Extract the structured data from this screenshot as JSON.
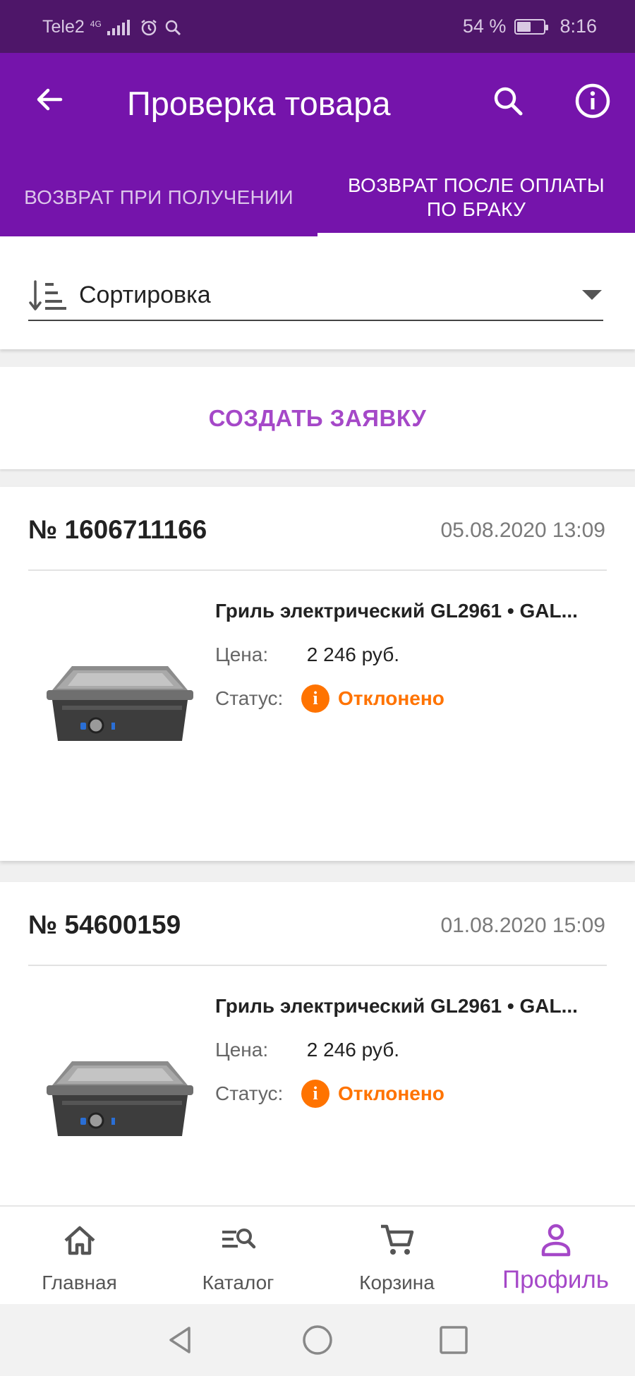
{
  "status_bar": {
    "carrier": "Tele2",
    "network": "4G",
    "battery": "54 %",
    "battery_level": 0.54,
    "time": "8:16"
  },
  "header": {
    "title": "Проверка товара",
    "icons": [
      "arrow-back-icon",
      "search-icon",
      "info-icon"
    ]
  },
  "tabs": [
    {
      "label": "ВОЗВРАТ ПРИ ПОЛУЧЕНИИ",
      "active": false
    },
    {
      "label": "ВОЗВРАТ ПОСЛЕ ОПЛАТЫ ПО БРАКУ",
      "active": true
    }
  ],
  "sort": {
    "label": "Сортировка"
  },
  "create_button": "СОЗДАТЬ ЗАЯВКУ",
  "orders": [
    {
      "number": "№ 1606711166",
      "date": "05.08.2020 13:09",
      "product": "Гриль электрический GL2961 • GAL...",
      "price_label": "Цена:",
      "price": "2 246 руб.",
      "status_label": "Статус:",
      "status": "Отклонено"
    },
    {
      "number": "№ 54600159",
      "date": "01.08.2020 15:09",
      "product": "Гриль электрический GL2961 • GAL...",
      "price_label": "Цена:",
      "price": "2 246 руб.",
      "status_label": "Статус:",
      "status": "Отклонено"
    }
  ],
  "bottom_nav": [
    {
      "label": "Главная",
      "icon": "home-icon",
      "active": false
    },
    {
      "label": "Каталог",
      "icon": "catalog-search-icon",
      "active": false
    },
    {
      "label": "Корзина",
      "icon": "cart-icon",
      "active": false
    },
    {
      "label": "Профиль",
      "icon": "profile-icon",
      "active": true
    }
  ],
  "colors": {
    "brand": "#7514ab",
    "status_bar": "#4e1669",
    "accent": "#a548c8",
    "status_rejected": "#ff7300"
  }
}
